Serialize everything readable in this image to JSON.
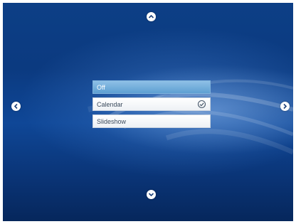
{
  "menu": {
    "items": [
      {
        "label": "Off",
        "selected": true
      },
      {
        "label": "Calendar",
        "selected": false,
        "checked": true
      },
      {
        "label": "Slideshow",
        "selected": false
      }
    ]
  },
  "icons": {
    "up": "chevron-up-icon",
    "down": "chevron-down-icon",
    "left": "chevron-left-icon",
    "right": "chevron-right-icon",
    "check": "check-circle-icon"
  },
  "colors": {
    "background": "#0d3f86",
    "selected_item": "#6aa8d8",
    "item_text": "#3a4a5c"
  }
}
